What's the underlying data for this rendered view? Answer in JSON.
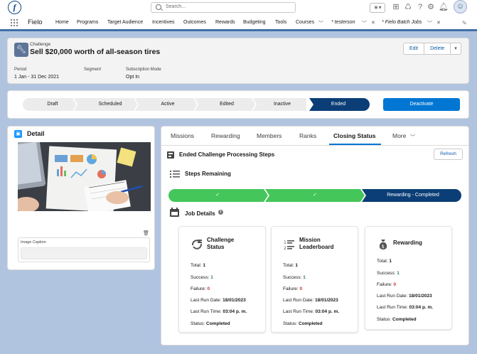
{
  "global": {
    "logo_letter": "f",
    "search_placeholder": "Search..."
  },
  "nav": {
    "app_name": "Fielo",
    "items": [
      "Home",
      "Programs",
      "Target Audience",
      "Incentives",
      "Outcomes",
      "Rewards",
      "Budgeting",
      "Tools",
      "Courses"
    ],
    "tabs": [
      "* testerson",
      "* Fielo Batch Jobs"
    ]
  },
  "record": {
    "object_label": "Challenge",
    "title": "Sell $20,000 worth of all-season tires",
    "actions": [
      "Edit",
      "Delete"
    ],
    "fields": [
      {
        "label": "Period",
        "value": "1 Jan - 31 Dec 2021"
      },
      {
        "label": "Segment",
        "value": ""
      },
      {
        "label": "Subscription Mode",
        "value": "Opt In"
      }
    ]
  },
  "path": {
    "steps": [
      "Draft",
      "Scheduled",
      "Active",
      "Edited",
      "Inactive",
      "Ended"
    ],
    "current": "Ended",
    "action_label": "Deactivate"
  },
  "detail": {
    "title": "Detail",
    "caption_label": "Image Caption",
    "caption_value": ""
  },
  "tabs": {
    "items": [
      "Missions",
      "Rewarding",
      "Members",
      "Ranks",
      "Closing Status",
      "More"
    ],
    "active": "Closing Status"
  },
  "closing": {
    "title": "Ended Challenge Processing Steps",
    "refresh_label": "Refresh",
    "steps_title": "Steps Remaining",
    "progress": [
      {
        "label": "",
        "status": "complete"
      },
      {
        "label": "",
        "status": "complete"
      },
      {
        "label": "Rewarding - Completed",
        "status": "current"
      }
    ],
    "jobs_title": "Job Details",
    "jobs": [
      {
        "title": "Challenge Status",
        "title_1": "Challenge",
        "title_2": "Status",
        "total_label": "Total:",
        "total": "1",
        "success_label": "Success:",
        "success": "1",
        "failure_label": "Failure:",
        "failure": "0",
        "date_label": "Last Run Date:",
        "date": "18/01/2023",
        "time_label": "Last Run Time:",
        "time": "03:04 p. m.",
        "status_label": "Status:",
        "status": "Completed"
      },
      {
        "title": "Mission Leaderboard",
        "title_1": "Mission",
        "title_2": "Leaderboard",
        "total_label": "Total:",
        "total": "1",
        "success_label": "Success:",
        "success": "1",
        "failure_label": "Failure:",
        "failure": "0",
        "date_label": "Last Run Date:",
        "date": "18/01/2023",
        "time_label": "Last Run Time:",
        "time": "03:04 p. m.",
        "status_label": "Status:",
        "status": "Completed"
      },
      {
        "title": "Rewarding",
        "title_1": "Rewarding",
        "title_2": "",
        "total_label": "Total:",
        "total": "1",
        "success_label": "Success:",
        "success": "1",
        "failure_label": "Failure:",
        "failure": "0",
        "date_label": "Last Run Date:",
        "date": "18/01/2023",
        "time_label": "Last Run Time:",
        "time": "03:04 p. m.",
        "status_label": "Status:",
        "status": "Completed"
      }
    ]
  },
  "colors": {
    "brand": "#0176d3",
    "path_current": "#0b3e76",
    "progress_complete": "#45c65a",
    "progress_current": "#0b3e76",
    "success": "#2e844a",
    "failure": "#c23934",
    "page_bg": "#b0c4df"
  }
}
